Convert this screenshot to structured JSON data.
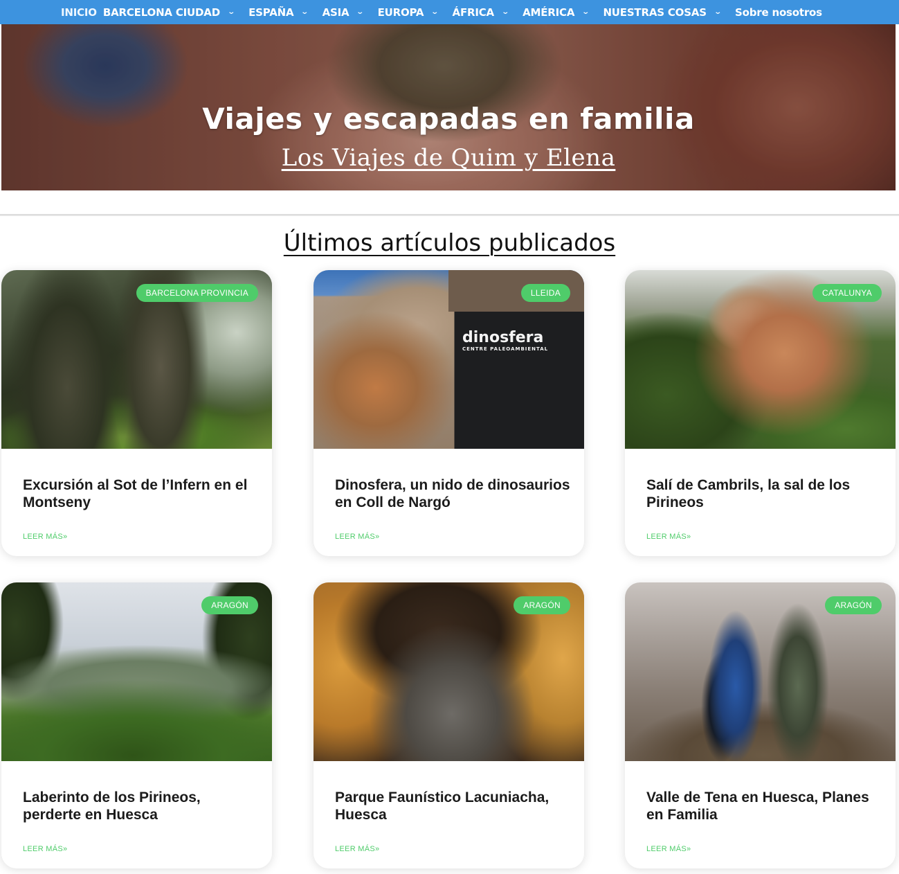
{
  "nav": {
    "items": [
      {
        "label": "INICIO",
        "has_dropdown": false
      },
      {
        "label": "BARCELONA CIUDAD",
        "has_dropdown": true
      },
      {
        "label": "ESPAÑA",
        "has_dropdown": true
      },
      {
        "label": "ASIA",
        "has_dropdown": true
      },
      {
        "label": "EUROPA",
        "has_dropdown": true
      },
      {
        "label": "ÁFRICA",
        "has_dropdown": true
      },
      {
        "label": "AMÉRICA",
        "has_dropdown": true
      },
      {
        "label": "NUESTRAS COSAS",
        "has_dropdown": true
      },
      {
        "label": "Sobre nosotros",
        "has_dropdown": false
      }
    ],
    "background_color": "#3d93df"
  },
  "hero": {
    "title": "Viajes y escapadas en familia",
    "subtitle_link": "Los Viajes de Quim y Elena"
  },
  "section": {
    "title": "Últimos artículos publicados"
  },
  "cards": [
    {
      "badge": "BARCELONA PROVINCIA",
      "title": "Excursión al Sot de l’Infern en el Montseny",
      "more": "LEER MÁS»",
      "image": "forest-photo"
    },
    {
      "badge": "LLEIDA",
      "title": "Dinosfera, un nido de dinosaurios en Coll de Nargó",
      "more": "LEER MÁS»",
      "image": "museum-photo",
      "sign_text": "dinosfera",
      "sign_sub": "CENTRE PALEOAMBIENTAL"
    },
    {
      "badge": "CATALUNYA",
      "title": "Salí de Cambrils, la sal de los Pirineos",
      "more": "LEER MÁS»",
      "image": "cliff-photo"
    },
    {
      "badge": "ARAGÓN",
      "title": "Laberinto de los Pirineos, perderte en Huesca",
      "more": "LEER MÁS»",
      "image": "mountain-photo"
    },
    {
      "badge": "ARAGÓN",
      "title": "Parque Faunístico Lacuniacha, Huesca",
      "more": "LEER MÁS»",
      "image": "mouflon-photo"
    },
    {
      "badge": "ARAGÓN",
      "title": "Valle de Tena en Huesca, Planes en Familia",
      "more": "LEER MÁS»",
      "image": "hikers-photo"
    }
  ],
  "colors": {
    "badge": "#4fcc6a",
    "read_more": "#4fcc6a"
  }
}
